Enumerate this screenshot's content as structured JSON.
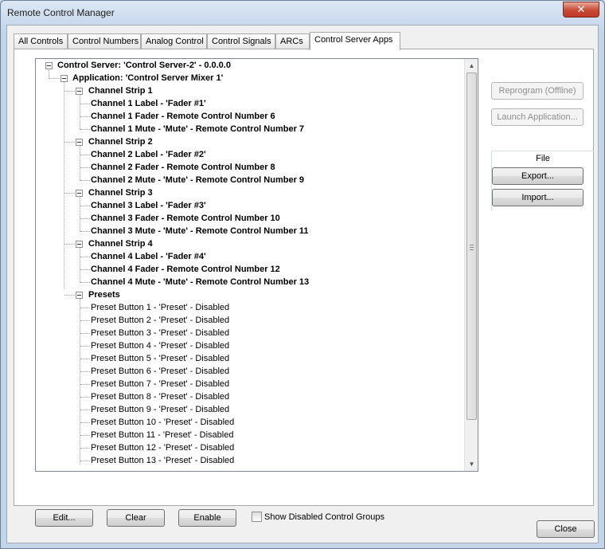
{
  "window": {
    "title": "Remote Control Manager",
    "close_glyph": "✕"
  },
  "tabs": [
    {
      "label": "All Controls"
    },
    {
      "label": "Control Numbers"
    },
    {
      "label": "Analog Control"
    },
    {
      "label": "Control Signals"
    },
    {
      "label": "ARCs"
    },
    {
      "label": "Control Server Apps"
    }
  ],
  "active_tab": "Control Server Apps",
  "tree": {
    "root": "Control Server: 'Control Server-2' - 0.0.0.0",
    "application": "Application: 'Control Server Mixer 1'",
    "strips": [
      {
        "name": "Channel Strip 1",
        "items": [
          "Channel 1 Label - 'Fader #1'",
          "Channel 1 Fader - Remote Control Number 6",
          "Channel 1 Mute - 'Mute' - Remote Control Number 7"
        ]
      },
      {
        "name": "Channel Strip 2",
        "items": [
          "Channel 2 Label - 'Fader #2'",
          "Channel 2 Fader - Remote Control Number 8",
          "Channel 2 Mute - 'Mute' - Remote Control Number 9"
        ]
      },
      {
        "name": "Channel Strip 3",
        "items": [
          "Channel 3 Label - 'Fader #3'",
          "Channel 3 Fader - Remote Control Number 10",
          "Channel 3 Mute - 'Mute' - Remote Control Number 11"
        ]
      },
      {
        "name": "Channel Strip 4",
        "items": [
          "Channel 4 Label - 'Fader #4'",
          "Channel 4 Fader - Remote Control Number 12",
          "Channel 4 Mute - 'Mute' - Remote Control Number 13"
        ]
      }
    ],
    "presets_label": "Presets",
    "presets": [
      "Preset Button 1 - 'Preset' - Disabled",
      "Preset Button 2 - 'Preset' - Disabled",
      "Preset Button 3 - 'Preset' - Disabled",
      "Preset Button 4 - 'Preset' - Disabled",
      "Preset Button 5 - 'Preset' - Disabled",
      "Preset Button 6 - 'Preset' - Disabled",
      "Preset Button 7 - 'Preset' - Disabled",
      "Preset Button 8 - 'Preset' - Disabled",
      "Preset Button 9 - 'Preset' - Disabled",
      "Preset Button 10 - 'Preset' - Disabled",
      "Preset Button 11 - 'Preset' - Disabled",
      "Preset Button 12 - 'Preset' - Disabled",
      "Preset Button 13 - 'Preset' - Disabled"
    ]
  },
  "side": {
    "reprogram": "Reprogram (Offline)",
    "launch": "Launch Application...",
    "file_group": "File",
    "export": "Export...",
    "import": "Import..."
  },
  "bottom": {
    "edit": "Edit...",
    "clear": "Clear",
    "enable": "Enable",
    "show_disabled": "Show Disabled Control Groups",
    "show_disabled_checked": false
  },
  "footer": {
    "close": "Close"
  },
  "icons": {
    "scroll_up": "▲",
    "scroll_down": "▼"
  }
}
